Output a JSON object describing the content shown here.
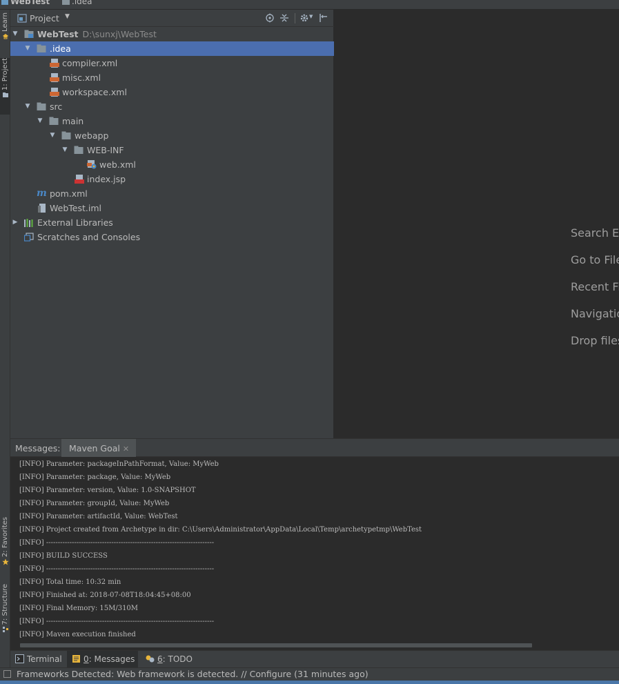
{
  "window": {
    "breadcrumb": [
      "WebTest",
      ".idea"
    ]
  },
  "left_stripe": {
    "tabs": [
      "Learn",
      "1: Project",
      "2: Favorites",
      "7: Structure"
    ]
  },
  "project_panel": {
    "title": "Project",
    "tree": [
      {
        "label": "WebTest",
        "path": "D:\\sunxj\\WebTest",
        "icon": "module-icon",
        "arrow": "expanded"
      },
      {
        "label": ".idea",
        "icon": "folder-icon",
        "arrow": "expanded",
        "selected": true
      },
      {
        "label": "compiler.xml",
        "icon": "xml-file-icon"
      },
      {
        "label": "misc.xml",
        "icon": "xml-file-icon"
      },
      {
        "label": "workspace.xml",
        "icon": "xml-file-icon"
      },
      {
        "label": "src",
        "icon": "folder-icon",
        "arrow": "expanded"
      },
      {
        "label": "main",
        "icon": "folder-icon",
        "arrow": "expanded"
      },
      {
        "label": "webapp",
        "icon": "folder-icon",
        "arrow": "expanded"
      },
      {
        "label": "WEB-INF",
        "icon": "folder-icon",
        "arrow": "expanded"
      },
      {
        "label": "web.xml",
        "icon": "web-xml-icon"
      },
      {
        "label": "index.jsp",
        "icon": "jsp-file-icon"
      },
      {
        "label": "pom.xml",
        "icon": "maven-icon"
      },
      {
        "label": "WebTest.iml",
        "icon": "iml-file-icon"
      },
      {
        "label": "External Libraries",
        "icon": "libraries-icon",
        "arrow": "collapsed"
      },
      {
        "label": "Scratches and Consoles",
        "icon": "scratches-icon"
      }
    ]
  },
  "editor_hints": [
    "Search Ev",
    "Go to File",
    "Recent Fi",
    "Navigatio",
    "Drop files"
  ],
  "messages": {
    "label": "Messages:",
    "tab": "Maven Goal",
    "lines": [
      "[INFO] Parameter: packageInPathFormat, Value: MyWeb",
      "[INFO] Parameter: package, Value: MyWeb",
      "[INFO] Parameter: version, Value: 1.0-SNAPSHOT",
      "[INFO] Parameter: groupId, Value: MyWeb",
      "[INFO] Parameter: artifactId, Value: WebTest",
      "[INFO] Project created from Archetype in dir: C:\\Users\\Administrator\\AppData\\Local\\Temp\\archetypetmp\\WebTest",
      "[INFO] ------------------------------------------------------------------------",
      "[INFO] BUILD SUCCESS",
      "[INFO] ------------------------------------------------------------------------",
      "[INFO] Total time: 10:32 min",
      "[INFO] Finished at: 2018-07-08T18:04:45+08:00",
      "[INFO] Final Memory: 15M/310M",
      "[INFO] ------------------------------------------------------------------------",
      "[INFO] Maven execution finished"
    ]
  },
  "bottom_tabs": {
    "terminal": "Terminal",
    "messages_num": "0",
    "messages_rest": ": Messages",
    "todo_num": "6",
    "todo_rest": ": TODO"
  },
  "status_bar": {
    "text": "Frameworks Detected: Web framework is detected. // Configure (31 minutes ago)"
  },
  "colors": {
    "selection": "#4b6eaf",
    "panel": "#3c3f41",
    "editor": "#2b2b2b"
  }
}
